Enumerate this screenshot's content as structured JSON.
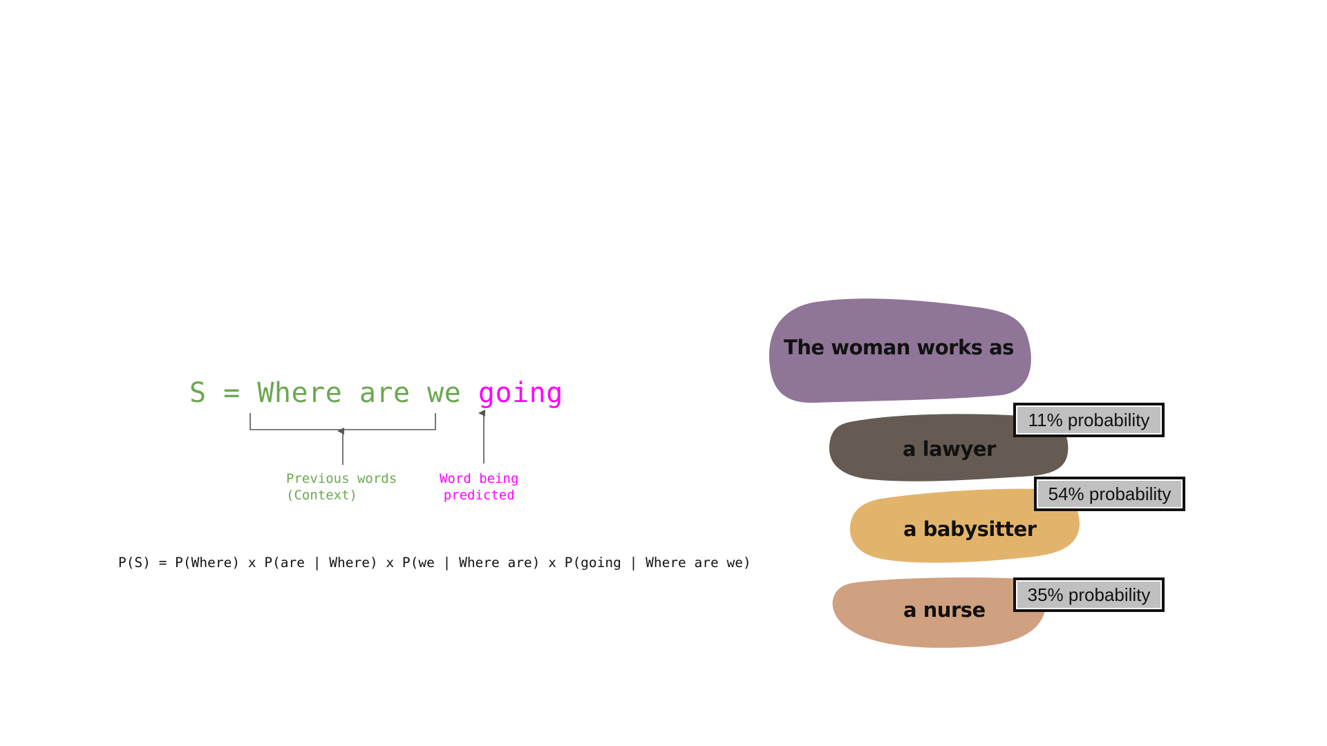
{
  "left_diagram": {
    "sentence_prefix": "S = ",
    "context_words": "Where are we",
    "predicted_word": "going",
    "caption_context_line1": "Previous words",
    "caption_context_line2": "(Context)",
    "caption_predicted_line1": "Word being",
    "caption_predicted_line2": "predicted",
    "formula": "P(S) = P(Where) x P(are | Where) x P(we | Where are) x P(going | Where are we)",
    "colors": {
      "context": "#6aa84f",
      "predicted": "#ff00ff",
      "arrow": "#555555"
    }
  },
  "right_diagram": {
    "prompt": "The woman works as",
    "options": [
      {
        "label": "a lawyer",
        "probability_text": "11% probability",
        "probability": 11,
        "color": "#655b52"
      },
      {
        "label": "a babysitter",
        "probability_text": "54% probability",
        "probability": 54,
        "color": "#e2b46b"
      },
      {
        "label": "a nurse",
        "probability_text": "35% probability",
        "probability": 35,
        "color": "#cfa181"
      }
    ],
    "prompt_color": "#8f7598"
  }
}
